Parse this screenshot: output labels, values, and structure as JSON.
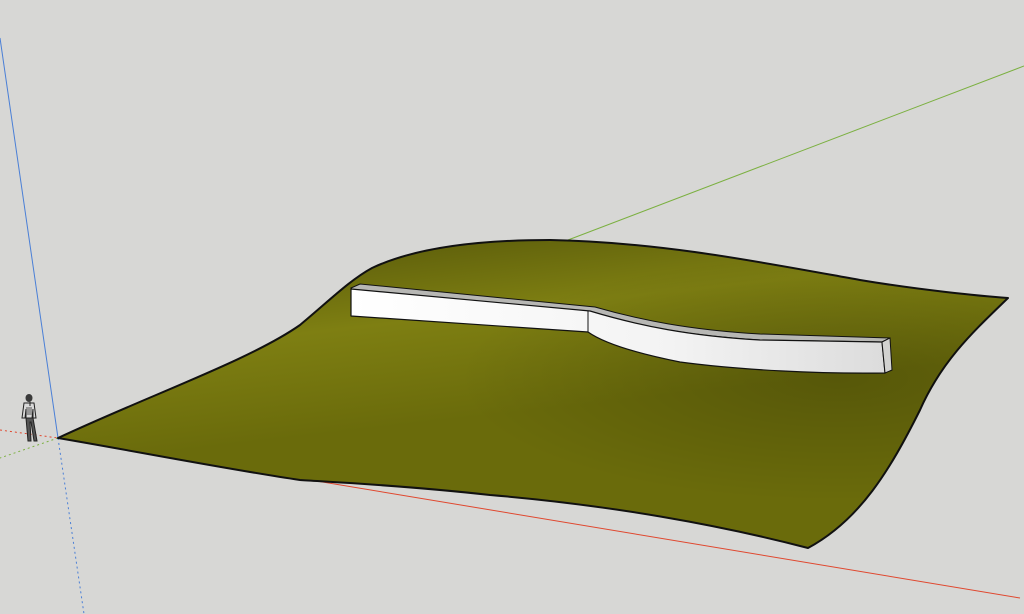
{
  "viewport": {
    "background": "#d7d7d5",
    "edge_color": "#111111"
  },
  "axes": {
    "red_axis": {
      "name": "red-axis",
      "color": "#e0472e"
    },
    "green_axis": {
      "name": "green-axis",
      "color": "#7bb040"
    },
    "blue_axis": {
      "name": "blue-axis",
      "color": "#4a7fd6"
    }
  },
  "terrain": {
    "name": "terrain-surface",
    "color_light": "#7e7f12",
    "color_mid": "#6a6b0b",
    "color_dark": "#4f5008"
  },
  "wall": {
    "name": "curved-wall",
    "face_color": "#ffffff",
    "shade_color": "#dcdcdc",
    "top_color": "#b7b7b4"
  },
  "scale_figure": {
    "name": "scale-figure",
    "icon": "person-icon"
  }
}
